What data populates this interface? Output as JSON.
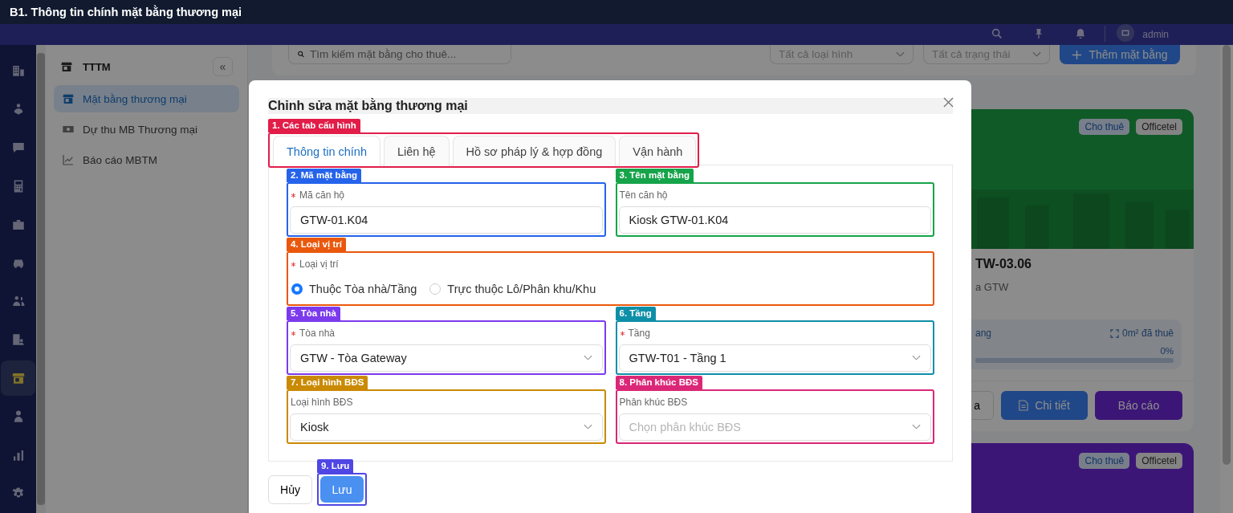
{
  "banner": {
    "title": "B1. Thông tin chính mặt bằng thương mại"
  },
  "header": {
    "user": "admin"
  },
  "rail": [
    {
      "kind": "building",
      "selected": false
    },
    {
      "kind": "helper",
      "selected": false
    },
    {
      "kind": "chat",
      "selected": false
    },
    {
      "kind": "calculator",
      "selected": false
    },
    {
      "kind": "briefcase",
      "selected": false
    },
    {
      "kind": "car",
      "selected": false
    },
    {
      "kind": "people",
      "selected": false
    },
    {
      "kind": "building-person",
      "selected": false
    },
    {
      "kind": "store",
      "selected": true
    },
    {
      "kind": "person",
      "selected": false
    },
    {
      "kind": "chart",
      "selected": false
    },
    {
      "kind": "gear",
      "selected": false
    }
  ],
  "sidebar": {
    "title": "TTTM",
    "collapse": "«",
    "items": [
      {
        "kind": "store",
        "label": "Mặt bằng thương mại",
        "selected": true
      },
      {
        "kind": "money",
        "label": "Dự thu MB Thương mại",
        "selected": false
      },
      {
        "kind": "trend",
        "label": "Báo cáo MBTM",
        "selected": false
      }
    ]
  },
  "toolbar": {
    "search_placeholder": "Tìm kiếm mặt bằng cho thuê...",
    "filters": [
      "Tất cả loại hình",
      "Tất cả trạng thái"
    ],
    "add_button": "Thêm mặt bằng"
  },
  "cards": [
    {
      "tags": [
        "Cho thuê",
        "Officetel"
      ],
      "title": "TW-03.06",
      "subtitle": "a GTW",
      "stat_label": "ang",
      "rented": "0m² đã thuê",
      "percent": "0%",
      "level": 0,
      "buttons": [
        {
          "kind": "outline",
          "label": "a"
        },
        {
          "kind": "detail",
          "label": "Chi tiết"
        },
        {
          "kind": "report",
          "label": "Báo cáo"
        }
      ]
    },
    {
      "tags": [
        "Cho thuê",
        "Officetel"
      ]
    }
  ],
  "modal": {
    "title": "Chỉnh sửa mặt bằng thương mại",
    "tab_frame": {
      "tag": "1. Các tab cấu hình",
      "color": "#e11d48"
    },
    "tabs": [
      {
        "label": "Thông tin chính",
        "selected": true
      },
      {
        "label": "Liên hệ",
        "selected": false
      },
      {
        "label": "Hồ sơ pháp lý & hợp đồng",
        "selected": false
      },
      {
        "label": "Vận hành",
        "selected": false
      }
    ],
    "fields": [
      {
        "kind": "input",
        "tag": "2. Mã mặt bằng",
        "color": "#2563eb",
        "label": "Mã căn hộ",
        "required": true,
        "value": "GTW-01.K04"
      },
      {
        "kind": "input",
        "tag": "3. Tên mặt bằng",
        "color": "#16a34a",
        "label": "Tên căn hộ",
        "required": false,
        "value": "Kiosk GTW-01.K04"
      },
      {
        "kind": "radio",
        "tag": "4. Loại vị trí",
        "color": "#ea580c",
        "label": "Loại vị trí",
        "required": true,
        "options": [
          {
            "label": "Thuộc Tòa nhà/Tầng",
            "selected": true
          },
          {
            "label": "Trực thuộc Lô/Phân khu/Khu",
            "selected": false
          }
        ]
      },
      {
        "kind": "select",
        "tag": "5. Tòa nhà",
        "color": "#7c3aed",
        "label": "Tòa nhà",
        "required": true,
        "value": "GTW - Tòa Gateway"
      },
      {
        "kind": "select",
        "tag": "6. Tầng",
        "color": "#0e8fa8",
        "label": "Tầng",
        "required": true,
        "value": "GTW-T01 - Tầng 1"
      },
      {
        "kind": "select",
        "tag": "7. Loại hình BĐS",
        "color": "#ca8a04",
        "label": "Loại hình BĐS",
        "required": false,
        "value": "Kiosk"
      },
      {
        "kind": "select",
        "tag": "8. Phân khúc BĐS",
        "color": "#db2777",
        "label": "Phân khúc BĐS",
        "required": false,
        "placeholder": "Chọn phân khúc BĐS"
      }
    ],
    "cancel": "Hủy",
    "save": {
      "label": "Lưu",
      "tag": "9. Lưu",
      "color": "#4f46e5"
    }
  }
}
